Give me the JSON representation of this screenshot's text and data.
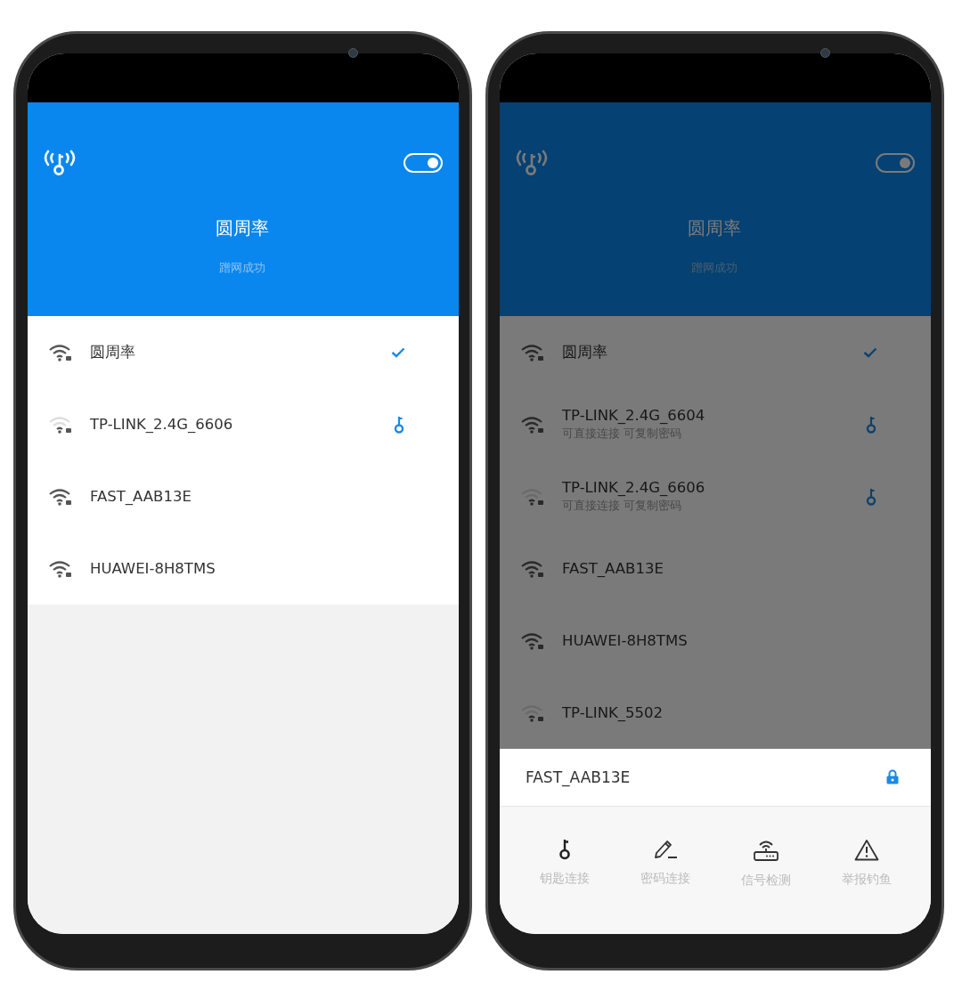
{
  "phones": [
    {
      "dimmed": false,
      "header": {
        "title": "圆周率",
        "subtitle": "蹭网成功",
        "toggle_on": true
      },
      "networks": [
        {
          "name": "圆周率",
          "weak_signal": false,
          "connected": true,
          "key_shared": false
        },
        {
          "name": "TP-LINK_2.4G_6606",
          "weak_signal": true,
          "connected": false,
          "key_shared": true
        },
        {
          "name": "FAST_AAB13E",
          "weak_signal": false,
          "connected": false,
          "key_shared": false
        },
        {
          "name": "HUAWEI-8H8TMS",
          "weak_signal": false,
          "connected": false,
          "key_shared": false
        }
      ]
    },
    {
      "dimmed": true,
      "header": {
        "title": "圆周率",
        "subtitle": "蹭网成功",
        "toggle_on": true
      },
      "networks": [
        {
          "name": "圆周率",
          "weak_signal": false,
          "connected": true,
          "key_shared": false
        },
        {
          "name": "TP-LINK_2.4G_6604",
          "note": "可直接连接 可复制密码",
          "weak_signal": false,
          "connected": false,
          "key_shared": true
        },
        {
          "name": "TP-LINK_2.4G_6606",
          "note": "可直接连接 可复制密码",
          "weak_signal": true,
          "connected": false,
          "key_shared": true
        },
        {
          "name": "FAST_AAB13E",
          "weak_signal": false,
          "connected": false,
          "key_shared": false
        },
        {
          "name": "HUAWEI-8H8TMS",
          "weak_signal": false,
          "connected": false,
          "key_shared": false
        },
        {
          "name": "TP-LINK_5502",
          "weak_signal": true,
          "connected": false,
          "key_shared": false
        }
      ],
      "sheet": {
        "network": "FAST_AAB13E",
        "actions": [
          {
            "kind": "key",
            "label": "钥匙连接"
          },
          {
            "kind": "password",
            "label": "密码连接"
          },
          {
            "kind": "signal",
            "label": "信号检测"
          },
          {
            "kind": "report",
            "label": "举报钓鱼"
          }
        ]
      }
    }
  ]
}
